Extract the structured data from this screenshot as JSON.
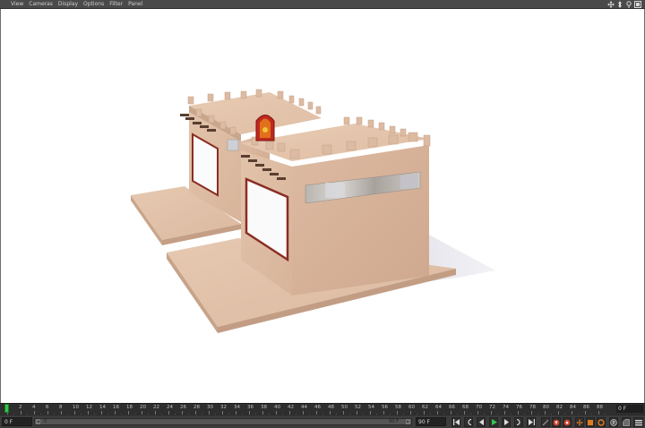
{
  "menu": {
    "items": [
      "View",
      "Cameras",
      "Display",
      "Options",
      "Filter",
      "Panel"
    ]
  },
  "nav_icons": [
    "move-view-icon",
    "scroll-view-icon",
    "zoom-view-icon",
    "toggle-layout-icon"
  ],
  "timeline": {
    "ticks": [
      "0",
      "2",
      "4",
      "6",
      "8",
      "10",
      "12",
      "14",
      "16",
      "18",
      "20",
      "22",
      "24",
      "26",
      "28",
      "30",
      "32",
      "34",
      "36",
      "38",
      "40",
      "42",
      "44",
      "46",
      "48",
      "50",
      "52",
      "54",
      "56",
      "58",
      "60",
      "62",
      "64",
      "66",
      "68",
      "70",
      "72",
      "74",
      "76",
      "78",
      "80",
      "82",
      "84",
      "86",
      "88",
      "90"
    ],
    "current_frame": "0 F"
  },
  "transport": {
    "start_field": "0 F",
    "range_start": "0",
    "range_end_label": "90 F",
    "end_field": "90 F"
  },
  "colors": {
    "accent_green": "#35c64a",
    "record_red": "#d2452b",
    "key_orange": "#e07b1e",
    "model_wall": "#d8b59b",
    "model_base": "#dcbca4",
    "shadow": "#e8e8ee",
    "window_frame": "#8a2d22",
    "door_red": "#c0281e"
  }
}
